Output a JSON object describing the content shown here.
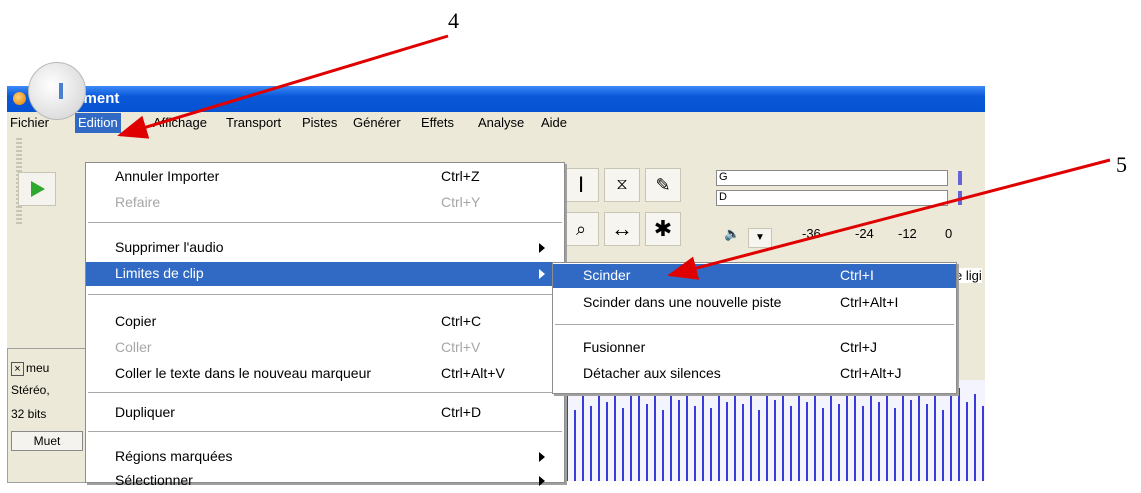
{
  "annotations": {
    "step4": "4",
    "step5": "5"
  },
  "window": {
    "title": "meuglement"
  },
  "menubar": [
    "Fichier",
    "Edition",
    "Affichage",
    "Transport",
    "Pistes",
    "Générer",
    "Effets",
    "Analyse",
    "Aide"
  ],
  "edit_menu": [
    {
      "label": "Annuler Importer",
      "shortcut": "Ctrl+Z"
    },
    {
      "label": "Refaire",
      "shortcut": "Ctrl+Y",
      "disabled": true
    },
    {
      "label": "Supprimer l'audio",
      "shortcut": ""
    },
    {
      "label": "Limites de clip",
      "shortcut": "",
      "highlighted": true
    },
    {
      "label": "Copier",
      "shortcut": "Ctrl+C"
    },
    {
      "label": "Coller",
      "shortcut": "Ctrl+V",
      "disabled": true
    },
    {
      "label": "Coller le texte dans le nouveau marqueur",
      "shortcut": "Ctrl+Alt+V"
    },
    {
      "label": "Dupliquer",
      "shortcut": "Ctrl+D"
    },
    {
      "label": "Régions marquées",
      "shortcut": ""
    },
    {
      "label": "Sélectionner",
      "shortcut": ""
    }
  ],
  "clip_submenu": [
    {
      "label": "Scinder",
      "shortcut": "Ctrl+I",
      "highlighted": true
    },
    {
      "label": "Scinder dans une nouvelle piste",
      "shortcut": "Ctrl+Alt+I"
    },
    {
      "label": "Fusionner",
      "shortcut": "Ctrl+J"
    },
    {
      "label": "Détacher aux silences",
      "shortcut": "Ctrl+Alt+J"
    }
  ],
  "meter": {
    "left": "G",
    "right": "D",
    "scale": [
      "-36",
      "-24",
      "-12",
      "0"
    ]
  },
  "toolbar": {
    "partial_text": "e ligi"
  },
  "track": {
    "name": "meu",
    "channels": "Stéréo,",
    "format": "32 bits",
    "mute": "Muet",
    "close": "×"
  },
  "colors": {
    "accent": "#316ac5",
    "arrow": "#e00000",
    "titlebar": "#0a58d8"
  }
}
